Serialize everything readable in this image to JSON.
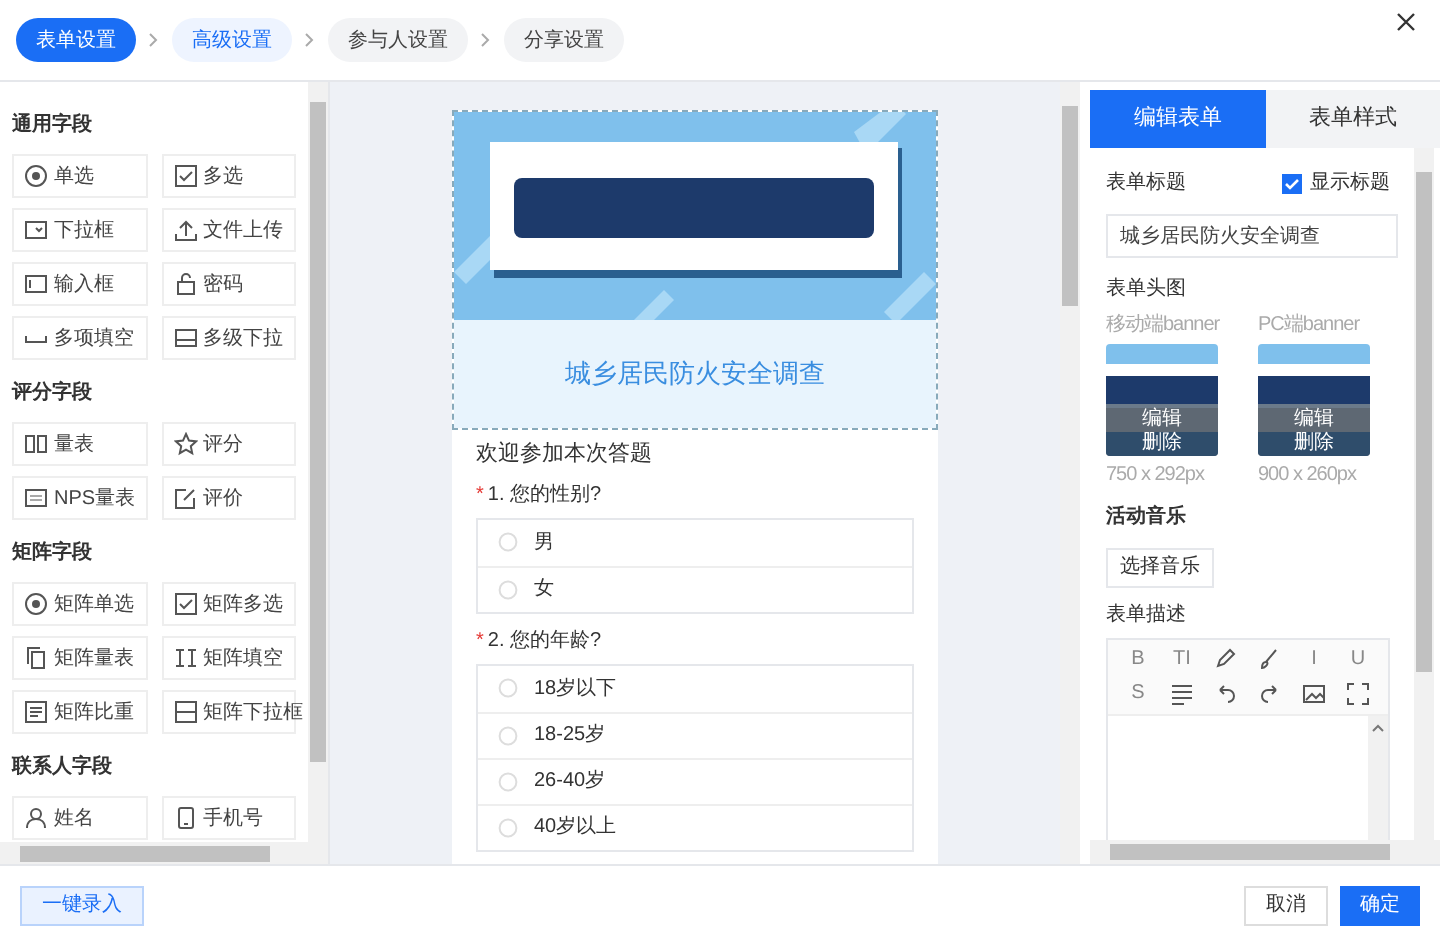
{
  "steps": [
    {
      "label": "表单设置",
      "selected": true
    },
    {
      "label": "高级设置",
      "selected": false,
      "visited": true
    },
    {
      "label": "参与人设置",
      "selected": false,
      "visited": false
    },
    {
      "label": "分享设置",
      "selected": false,
      "visited": false
    }
  ],
  "field_groups": [
    {
      "title": "通用字段",
      "items": [
        "单选",
        "多选",
        "下拉框",
        "文件上传",
        "输入框",
        "密码",
        "多项填空",
        "多级下拉"
      ]
    },
    {
      "title": "评分字段",
      "items": [
        "量表",
        "评分",
        "NPS量表",
        "评价"
      ]
    },
    {
      "title": "矩阵字段",
      "items": [
        "矩阵单选",
        "矩阵多选",
        "矩阵量表",
        "矩阵填空",
        "矩阵比重",
        "矩阵下拉框"
      ]
    },
    {
      "title": "联系人字段",
      "items": [
        "姓名",
        "手机号"
      ]
    }
  ],
  "form": {
    "subtitle": "城乡居民防火安全调查",
    "welcome": "欢迎参加本次答题",
    "questions": [
      {
        "required_mark": "*",
        "title": "1. 您的性别?",
        "options": [
          "男",
          "女"
        ]
      },
      {
        "required_mark": "*",
        "title": "2. 您的年龄?",
        "options": [
          "18岁以下",
          "18-25岁",
          "26-40岁",
          "40岁以上"
        ]
      }
    ]
  },
  "right_tabs": [
    {
      "label": "编辑表单",
      "selected": true
    },
    {
      "label": "表单样式",
      "selected": false
    }
  ],
  "settings": {
    "title_label": "表单标题",
    "show_title": {
      "label": "显示标题",
      "checked": true
    },
    "title_value": "城乡居民防火安全调查",
    "header_label": "表单头图",
    "banners": [
      {
        "label": "移动端banner",
        "edit": "编辑",
        "delete": "删除",
        "size": "750 x 292px"
      },
      {
        "label": "PC端banner",
        "edit": "编辑",
        "delete": "删除",
        "size": "900 x 260px"
      }
    ],
    "music_label": "活动音乐",
    "music_button": "选择音乐",
    "description_label": "表单描述",
    "toolbar": [
      {
        "kind": "text",
        "text": "B"
      },
      {
        "kind": "text",
        "text": "TI"
      },
      {
        "kind": "icon"
      },
      {
        "kind": "icon"
      },
      {
        "kind": "text",
        "text": "I"
      },
      {
        "kind": "text",
        "text": "U"
      },
      {
        "kind": "text",
        "text": "S"
      },
      {
        "kind": "icon"
      },
      {
        "kind": "icon"
      },
      {
        "kind": "icon"
      },
      {
        "kind": "icon"
      },
      {
        "kind": "icon"
      }
    ]
  },
  "footer": {
    "import_button": "一键录入",
    "cancel_button": "取消",
    "ok_button": "确定"
  }
}
